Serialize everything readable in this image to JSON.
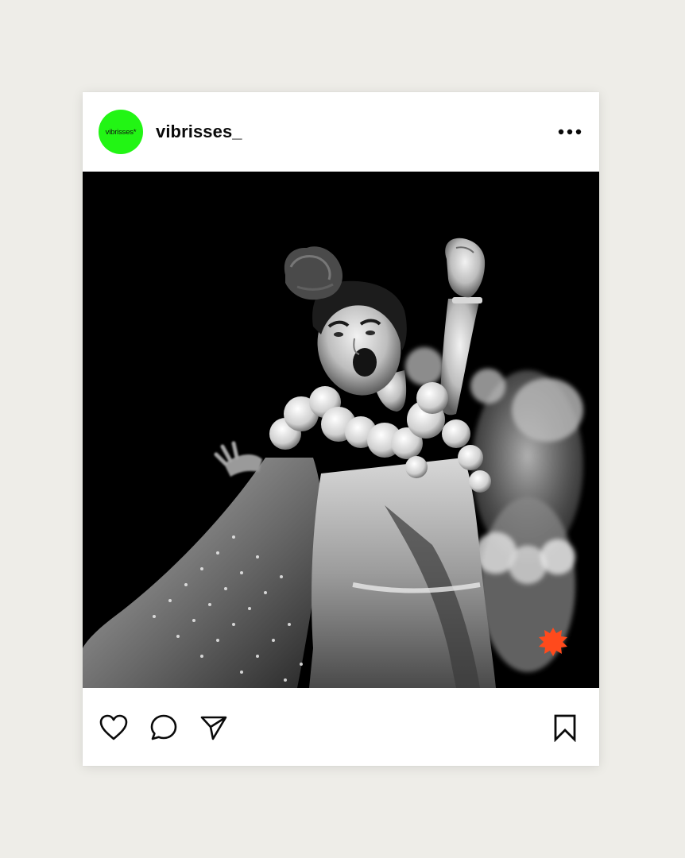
{
  "post": {
    "username": "vibrisses_",
    "avatar_text": "vibrisses*",
    "avatar_color": "#22f514",
    "more_icon": "more-horizontal-icon"
  },
  "photo": {
    "kind": "black-and-white stage performance photograph",
    "badge_icon": "starburst-icon",
    "badge_color": "#ff4a1c"
  },
  "actions": {
    "like_icon": "heart-icon",
    "comment_icon": "comment-icon",
    "share_icon": "send-icon",
    "save_icon": "bookmark-icon"
  }
}
